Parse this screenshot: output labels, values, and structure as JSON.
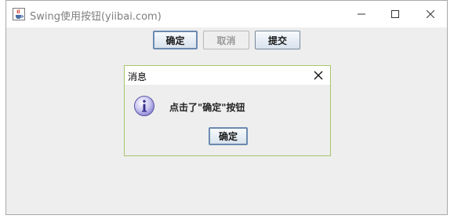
{
  "window": {
    "title": "Swing使用按钮(yiibai.com)",
    "icons": {
      "app": "java-cup-icon",
      "minimize": "minimize-icon",
      "maximize": "maximize-icon",
      "close": "close-icon"
    }
  },
  "toolbar": {
    "confirm_label": "确定",
    "cancel_label": "取消",
    "submit_label": "提交"
  },
  "dialog": {
    "title": "消息",
    "message": "点击了\"确定\"按钮",
    "ok_label": "确定",
    "icon": "info-icon",
    "close_icon": "close-icon"
  }
}
